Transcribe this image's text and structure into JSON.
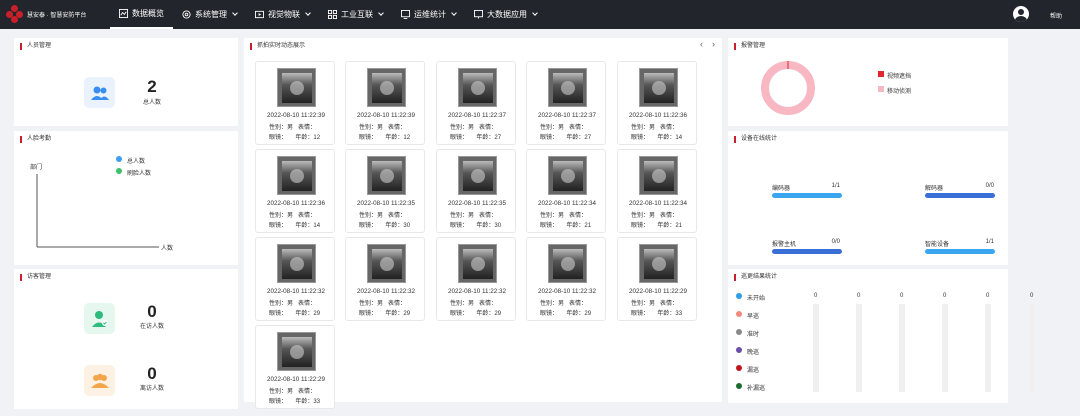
{
  "app": {
    "brand": "慧安泰 · 智慧安防平台"
  },
  "nav": [
    {
      "label": "数据概览",
      "active": true,
      "icon": "chart-icon"
    },
    {
      "label": "系统管理",
      "icon": "gear-icon"
    },
    {
      "label": "视觉物联",
      "icon": "video-icon"
    },
    {
      "label": "工业互联",
      "icon": "grid-icon"
    },
    {
      "label": "运维统计",
      "icon": "monitor-icon"
    },
    {
      "label": "大数据应用",
      "icon": "screen-icon"
    }
  ],
  "header": {
    "help": "帮助"
  },
  "personnel": {
    "title": "人员管理",
    "total": "2",
    "total_label": "总人数"
  },
  "attendance": {
    "title": "人脸考勤",
    "y_label": "部门",
    "x_label": "人数",
    "legend": [
      "总人数",
      "刷脸人数"
    ],
    "colors": [
      "#3a9ff5",
      "#3cc06b"
    ]
  },
  "visitors": {
    "title": "访客管理",
    "present": "0",
    "present_label": "在访人数",
    "left": "0",
    "left_label": "离访人数"
  },
  "capture": {
    "title": "抓拍实时动态展示",
    "prev": "‹",
    "next": "›",
    "gender_label": "性别：",
    "expr_label": "表情：",
    "glasses_label": "眼镜：",
    "age_label": "年龄：",
    "cards": [
      {
        "time": "2022-08-10 11:22:39",
        "gender": "男",
        "age": "12"
      },
      {
        "time": "2022-08-10 11:22:39",
        "gender": "男",
        "age": "12"
      },
      {
        "time": "2022-08-10 11:22:37",
        "gender": "男",
        "age": "27"
      },
      {
        "time": "2022-08-10 11:22:37",
        "gender": "男",
        "age": "27"
      },
      {
        "time": "2022-08-10 11:22:36",
        "gender": "男",
        "age": "14"
      },
      {
        "time": "2022-08-10 11:22:36",
        "gender": "男",
        "age": "14"
      },
      {
        "time": "2022-08-10 11:22:35",
        "gender": "男",
        "age": "30"
      },
      {
        "time": "2022-08-10 11:22:35",
        "gender": "男",
        "age": "30"
      },
      {
        "time": "2022-08-10 11:22:34",
        "gender": "男",
        "age": "21"
      },
      {
        "time": "2022-08-10 11:22:34",
        "gender": "男",
        "age": "21"
      },
      {
        "time": "2022-08-10 11:22:32",
        "gender": "男",
        "age": "29"
      },
      {
        "time": "2022-08-10 11:22:32",
        "gender": "男",
        "age": "29"
      },
      {
        "time": "2022-08-10 11:22:32",
        "gender": "男",
        "age": "29"
      },
      {
        "time": "2022-08-10 11:22:32",
        "gender": "男",
        "age": "29"
      },
      {
        "time": "2022-08-10 11:22:29",
        "gender": "男",
        "age": "33"
      },
      {
        "time": "2022-08-10 11:22:29",
        "gender": "男",
        "age": "33"
      }
    ]
  },
  "alarm": {
    "title": "报警管理",
    "legend": [
      "视频遮挡",
      "移动侦测"
    ],
    "colors": [
      "#e0262d",
      "#f7b8c4"
    ],
    "ring_color": "#f7b8c4"
  },
  "devices": {
    "title": "设备在线统计",
    "items": [
      {
        "name": "编码器",
        "value": "1/1",
        "color": "#3aa6f0"
      },
      {
        "name": "解码器",
        "value": "0/0",
        "color": "#3b6fd8"
      },
      {
        "name": "报警主机",
        "value": "0/0",
        "color": "#3b6fd8"
      },
      {
        "name": "智能设备",
        "value": "1/1",
        "color": "#3aa6f0"
      }
    ]
  },
  "patrol": {
    "title": "巡更结果统计",
    "legend": [
      "未开始",
      "早巡",
      "准时",
      "晚巡",
      "漏巡",
      "补漏巡"
    ],
    "colors": [
      "#2e9de8",
      "#f08b7e",
      "#8a8a8a",
      "#6b4fa8",
      "#c0161b",
      "#1c6b2f"
    ],
    "values": [
      "0",
      "0",
      "0",
      "0",
      "0",
      "0"
    ]
  }
}
